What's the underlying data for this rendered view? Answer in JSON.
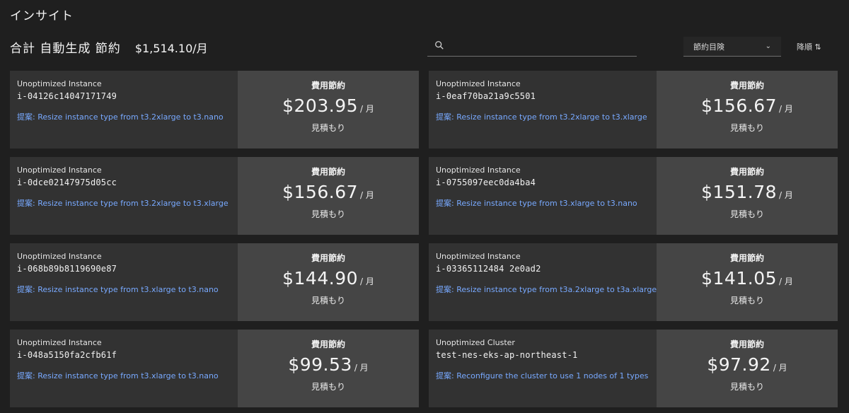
{
  "page": {
    "title": "インサイト"
  },
  "summary": {
    "label": "合計 自動生成 節約",
    "value": "$1,514.10/月"
  },
  "search": {
    "placeholder": "",
    "icon": "search-icon"
  },
  "sort": {
    "selected": "節約目険",
    "order_label": "降順 ⇅"
  },
  "card_labels": {
    "savings": "費用節約",
    "per_month": "/ 月",
    "estimate": "見積もり"
  },
  "cards": [
    {
      "type": "Unoptimized Instance",
      "id": "i-04126c14047171749",
      "recommendation": "提案: Resize instance type from t3.2xlarge to t3.nano",
      "amount": "$203.95"
    },
    {
      "type": "Unoptimized Instance",
      "id": "i-0eaf70ba21a9c5501",
      "recommendation": "提案: Resize instance type from t3.2xlarge to t3.xlarge",
      "amount": "$156.67"
    },
    {
      "type": "Unoptimized Instance",
      "id": "i-0dce02147975d05cc",
      "recommendation": "提案: Resize instance type from t3.2xlarge to t3.xlarge",
      "amount": "$156.67"
    },
    {
      "type": "Unoptimized Instance",
      "id": "i-0755097eec0da4ba4",
      "recommendation": "提案: Resize instance type from t3.xlarge to t3.nano",
      "amount": "$151.78"
    },
    {
      "type": "Unoptimized Instance",
      "id": "i-068b89b8119690e87",
      "recommendation": "提案: Resize instance type from t3.xlarge to t3.nano",
      "amount": "$144.90"
    },
    {
      "type": "Unoptimized Instance",
      "id": "i-03365112484 2e0ad2",
      "recommendation": "提案: Resize instance type from t3a.2xlarge to t3a.xlarge",
      "amount": "$141.05"
    },
    {
      "type": "Unoptimized Instance",
      "id": "i-048a5150fa2cfb61f",
      "recommendation": "提案: Resize instance type from t3.xlarge to t3.nano",
      "amount": "$99.53"
    },
    {
      "type": "Unoptimized Cluster",
      "id": "test-nes-eks-ap-northeast-1",
      "recommendation": "提案: Reconfigure the cluster to use 1 nodes of 1 types",
      "amount": "$97.92"
    }
  ]
}
